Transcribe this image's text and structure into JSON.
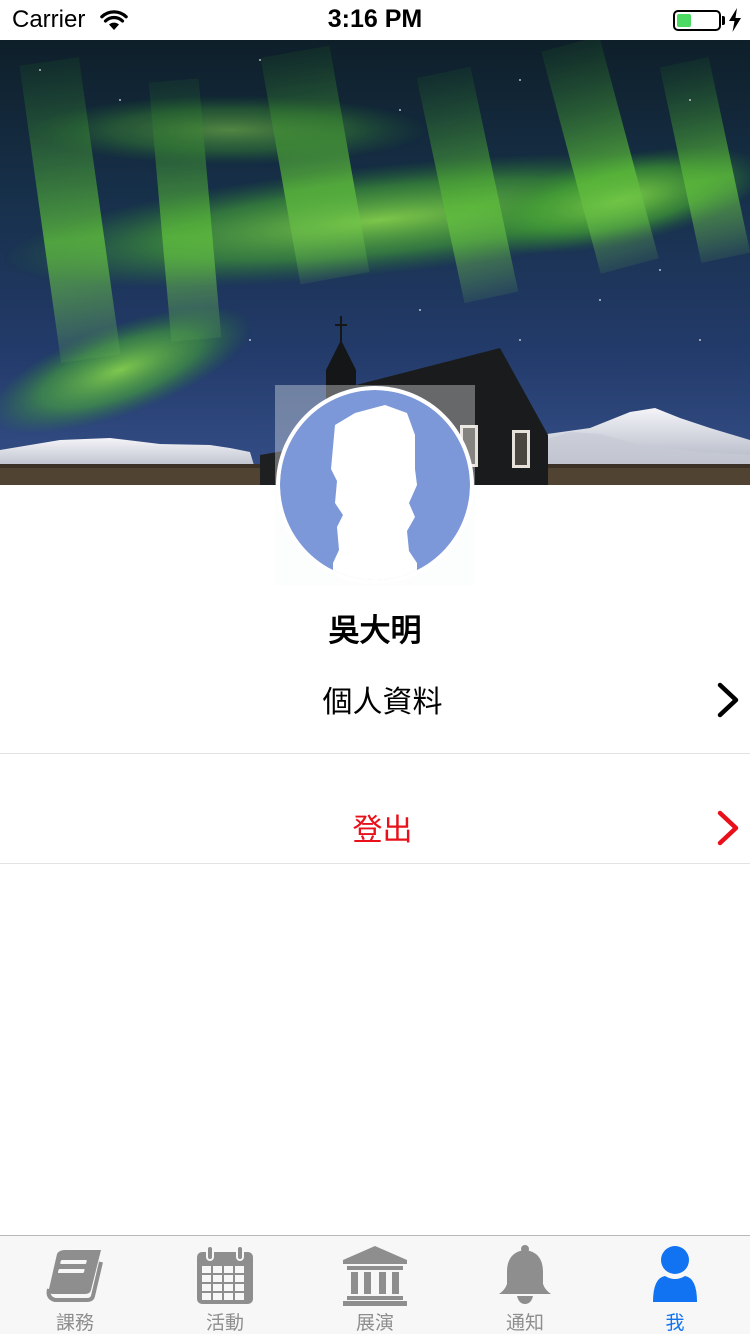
{
  "status_bar": {
    "carrier": "Carrier",
    "time": "3:16 PM",
    "battery_level": 0.35,
    "battery_color": "#4cd964"
  },
  "header": {
    "image_icon": "aurora-church-photo"
  },
  "profile": {
    "avatar_icon": "default-user-silhouette-icon",
    "avatar_color": "#7d98d9",
    "name": "吳大明"
  },
  "menu": {
    "items": [
      {
        "label": "個人資料",
        "color": "#000000",
        "icon": "chevron-right-icon"
      },
      {
        "label": "登出",
        "color": "#e8101a",
        "icon": "chevron-right-icon"
      }
    ]
  },
  "tab_bar": {
    "active_color": "#1273f2",
    "inactive_color": "#8e8e8e",
    "tabs": [
      {
        "label": "課務",
        "icon": "book-icon",
        "active": false
      },
      {
        "label": "活動",
        "icon": "calendar-icon",
        "active": false
      },
      {
        "label": "展演",
        "icon": "museum-icon",
        "active": false
      },
      {
        "label": "通知",
        "icon": "bell-icon",
        "active": false
      },
      {
        "label": "我",
        "icon": "user-icon",
        "active": true
      }
    ]
  }
}
